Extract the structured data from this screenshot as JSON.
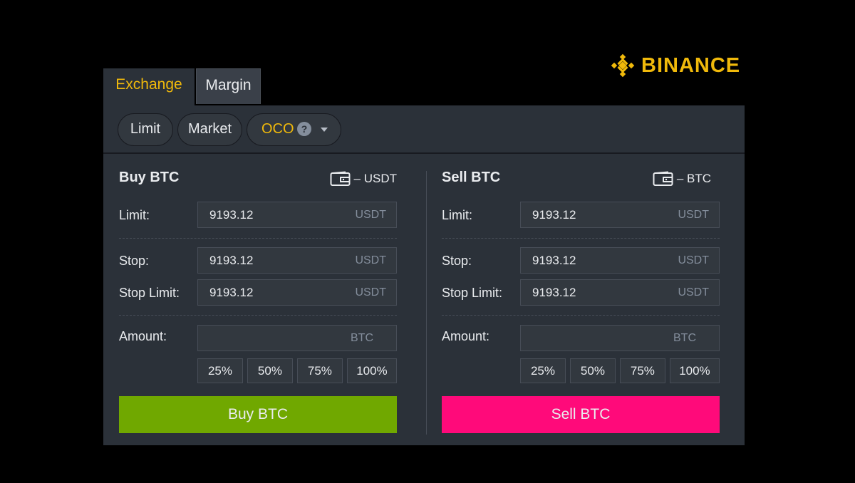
{
  "brand": {
    "name": "BINANCE",
    "accent": "#F0B90B"
  },
  "tabs": [
    {
      "label": "Exchange",
      "active": true
    },
    {
      "label": "Margin",
      "active": false
    }
  ],
  "order_types": [
    {
      "label": "Limit"
    },
    {
      "label": "Market"
    },
    {
      "label": "OCO",
      "active": true,
      "help_icon": "question-icon",
      "dropdown_icon": "caret-down-icon"
    }
  ],
  "buy": {
    "title": "Buy BTC",
    "wallet": "– USDT",
    "limit_label": "Limit:",
    "limit_value": "9193.12",
    "limit_unit": "USDT",
    "stop_label": "Stop:",
    "stop_value": "9193.12",
    "stop_unit": "USDT",
    "stop_limit_label": "Stop Limit:",
    "stop_limit_value": "9193.12",
    "stop_limit_unit": "USDT",
    "amount_label": "Amount:",
    "amount_value": "",
    "amount_unit": "BTC",
    "percents": [
      "25%",
      "50%",
      "75%",
      "100%"
    ],
    "button": "Buy BTC",
    "button_color": "#70A800"
  },
  "sell": {
    "title": "Sell BTC",
    "wallet": "– BTC",
    "limit_label": "Limit:",
    "limit_value": "9193.12",
    "limit_unit": "USDT",
    "stop_label": "Stop:",
    "stop_value": "9193.12",
    "stop_unit": "USDT",
    "stop_limit_label": "Stop Limit:",
    "stop_limit_value": "9193.12",
    "stop_limit_unit": "USDT",
    "amount_label": "Amount:",
    "amount_value": "",
    "amount_unit": "BTC",
    "percents": [
      "25%",
      "50%",
      "75%",
      "100%"
    ],
    "button": "Sell BTC",
    "button_color": "#FF0A7A"
  }
}
